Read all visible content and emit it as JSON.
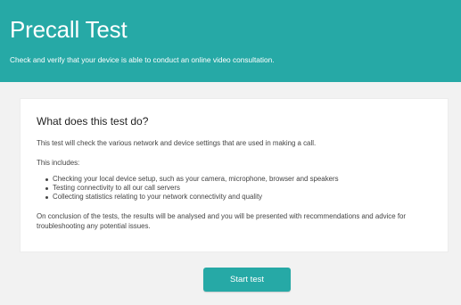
{
  "header": {
    "title": "Precall Test",
    "subtitle": "Check and verify that your device is able to conduct an online video consultation."
  },
  "card": {
    "heading": "What does this test do?",
    "intro": "This test will check the various network and device settings that are used in making a call.",
    "includes_label": "This includes:",
    "bullets": [
      "Checking your local device setup, such as your camera, microphone, browser and speakers",
      "Testing connectivity to all our call servers",
      "Collecting statistics relating to your network connectivity and quality"
    ],
    "conclusion": "On conclusion of the tests, the results will be analysed and you will be presented with recommendations and advice for troubleshooting any potential issues."
  },
  "actions": {
    "start_label": "Start test"
  },
  "colors": {
    "accent": "#26a9a6",
    "background": "#f2f2f2",
    "card": "#ffffff"
  }
}
